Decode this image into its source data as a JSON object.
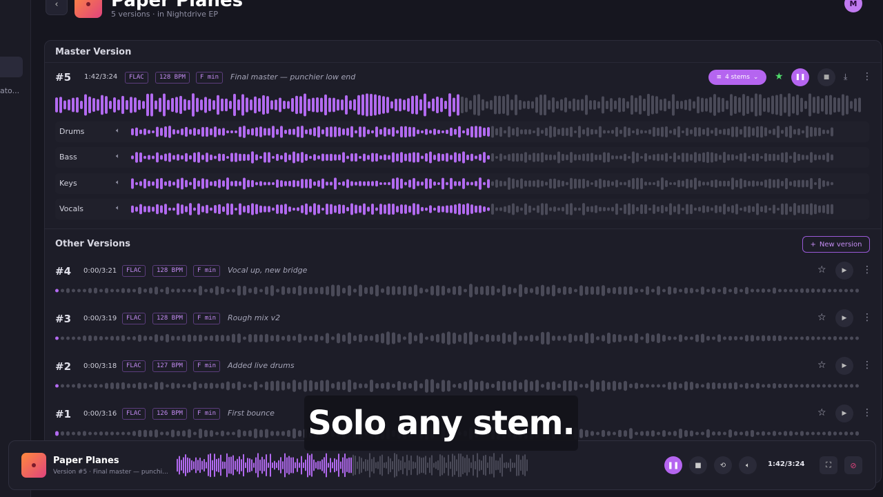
{
  "header": {
    "title": "Paper Planes",
    "subtitle": "5 versions · in Nightdrive EP",
    "back_icon": "‹",
    "avatar_initial": "M"
  },
  "sidebar": {
    "truncated_item": "ato..."
  },
  "master": {
    "section_title": "Master Version",
    "number": "#5",
    "time": "1:42/3:24",
    "format": "FLAC",
    "bpm": "128 BPM",
    "key": "F min",
    "description": "Final master — punchier low end",
    "stems_button": "4 stems",
    "progress": 0.5,
    "stems": [
      {
        "label": "Drums",
        "progress": 0.51
      },
      {
        "label": "Bass",
        "progress": 0.51
      },
      {
        "label": "Keys",
        "progress": 0.51
      },
      {
        "label": "Vocals",
        "progress": 0.51
      }
    ]
  },
  "other": {
    "section_title": "Other Versions",
    "new_version_label": "New version",
    "versions": [
      {
        "number": "#4",
        "time": "0:00/3:21",
        "format": "FLAC",
        "bpm": "128 BPM",
        "key": "F min",
        "description": "Vocal up, new bridge"
      },
      {
        "number": "#3",
        "time": "0:00/3:19",
        "format": "FLAC",
        "bpm": "128 BPM",
        "key": "F min",
        "description": "Rough mix v2"
      },
      {
        "number": "#2",
        "time": "0:00/3:18",
        "format": "FLAC",
        "bpm": "127 BPM",
        "key": "F min",
        "description": "Added live drums"
      },
      {
        "number": "#1",
        "time": "0:00/3:16",
        "format": "FLAC",
        "bpm": "126 BPM",
        "key": "F min",
        "description": "First bounce"
      }
    ]
  },
  "player": {
    "title": "Paper Planes",
    "subtitle": "Version #5 · Final master — punchi...",
    "time": "1:42/3:24",
    "progress": 0.5
  },
  "caption": "Solo any stem.",
  "colors": {
    "accent": "#b565f0",
    "wave_played": "#b26af0",
    "wave_unplayed": "#4a4a58",
    "star_active": "#4fdb6a",
    "cover_start": "#ff8a3d",
    "cover_end": "#e0437d"
  },
  "icons": {
    "back": "chevron-left-icon",
    "stems": "stems-icon",
    "star": "star-icon",
    "pause": "pause-icon",
    "stop": "stop-icon",
    "download": "download-icon",
    "more": "more-vertical-icon",
    "speaker": "speaker-icon",
    "play": "play-icon",
    "repeat": "repeat-icon",
    "volume": "volume-icon",
    "fullscreen": "fullscreen-icon",
    "close": "block-icon"
  }
}
